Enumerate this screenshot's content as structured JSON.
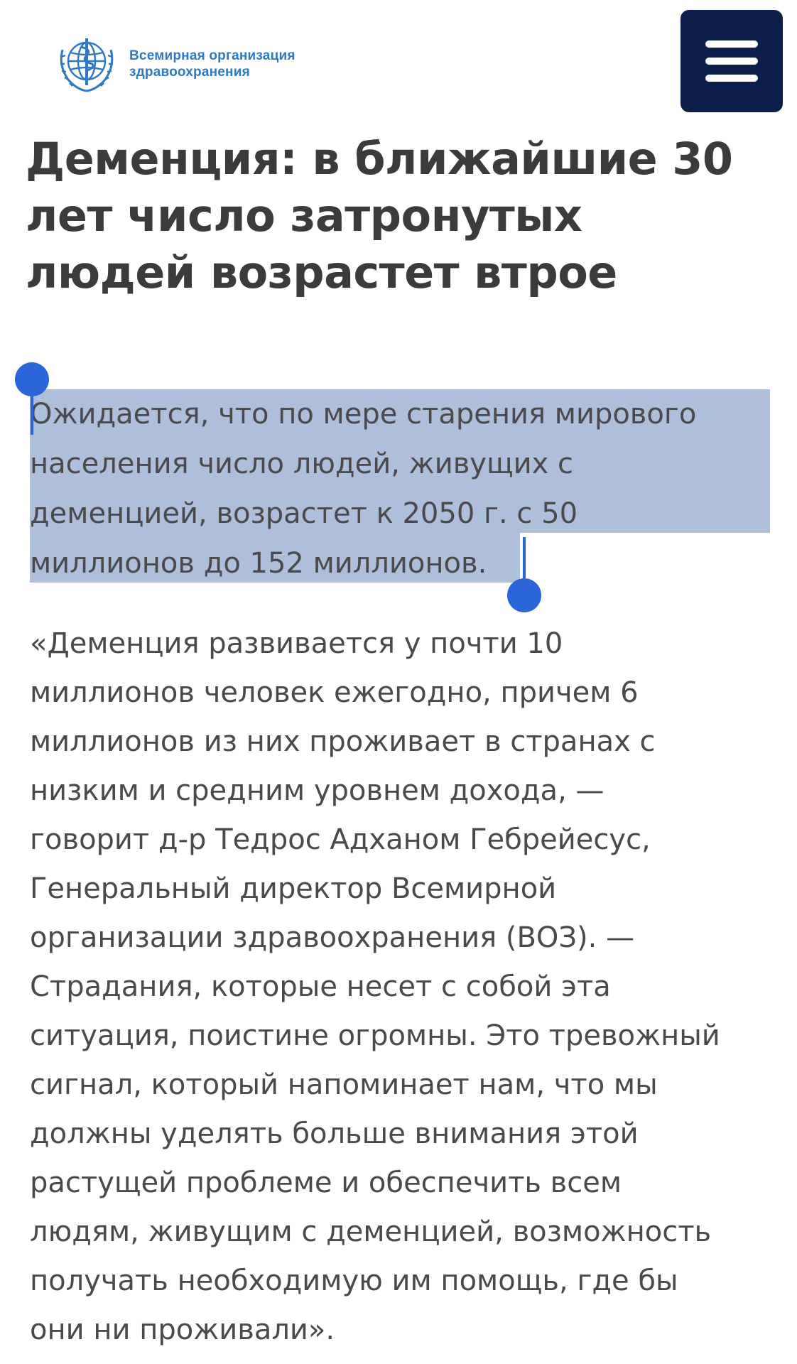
{
  "header": {
    "org_name_line1": "Всемирная организация",
    "org_name_line2": "здравоохранения",
    "logo_icon": "who-emblem-icon",
    "menu_icon": "hamburger-menu-icon",
    "menu_color": "#0c1f4a",
    "brand_color": "#2f78c4"
  },
  "article": {
    "title_lines": [
      "Деменция: в ближайшие 30",
      "лет число затронутых",
      "людей возрастет втрое"
    ],
    "lead_lines": [
      "Ожидается, что по мере старения мирового",
      "населения число людей, живущих с",
      "деменцией, возрастет к 2050 г. с 50",
      "миллионов до 152 миллионов."
    ],
    "selection_color": "#aebfd9",
    "selection_handle_color": "#2b66d9",
    "quote_lines": [
      "«Деменция развивается у почти 10",
      "миллионов человек ежегодно, причем 6",
      "миллионов из них проживает в странах с",
      "низким и средним уровнем дохода, —",
      "говорит д-р Тедрос Адханом Гебрейесус,",
      "Генеральный директор Всемирной",
      "организации здравоохранения (ВОЗ). —",
      "Страдания, которые несет с собой эта",
      "ситуация, поистине огромны. Это тревожный",
      "сигнал, который напоминает нам, что мы",
      "должны уделять больше внимания этой",
      "растущей проблеме и обеспечить всем",
      "людям, живущим с деменцией, возможность",
      "получать необходимую им помощь, где бы",
      "они ни проживали»."
    ]
  }
}
